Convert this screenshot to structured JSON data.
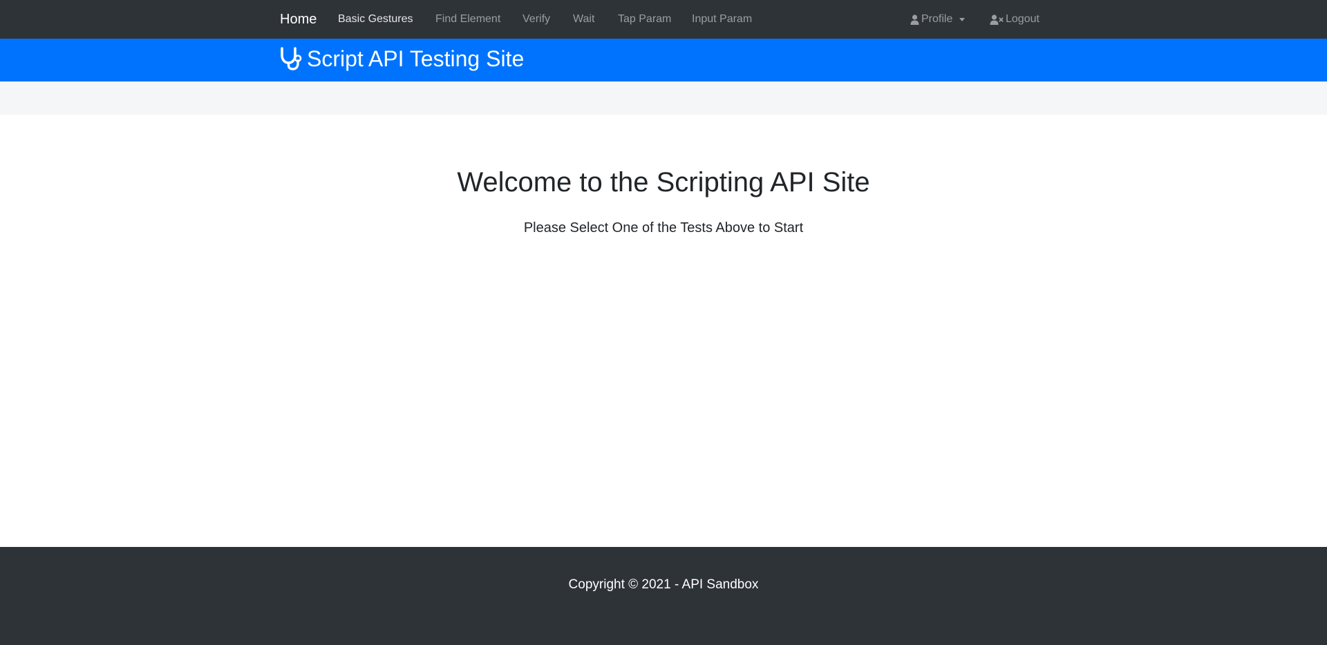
{
  "navbar": {
    "brand": "Home",
    "links": [
      "Basic Gestures",
      "Find Element",
      "Verify",
      "Wait",
      "Tap Param",
      "Input Param"
    ],
    "profile_label": "Profile",
    "logout_label": "Logout",
    "profile_icon": "user-icon",
    "logout_icon": "user-times-icon"
  },
  "banner": {
    "icon": "stethoscope-icon",
    "title": "Script API Testing Site"
  },
  "main": {
    "heading": "Welcome to the Scripting API Site",
    "subheading": "Please Select One of the Tests Above to Start"
  },
  "footer": {
    "copyright": "Copyright © 2021 - API Sandbox"
  },
  "colors": {
    "navbar_bg": "#2e3338",
    "banner_bg": "#0073fe",
    "subbar_bg": "#f5f6f8",
    "text_dark": "#212529",
    "nav_muted": "#9a9ea3"
  }
}
